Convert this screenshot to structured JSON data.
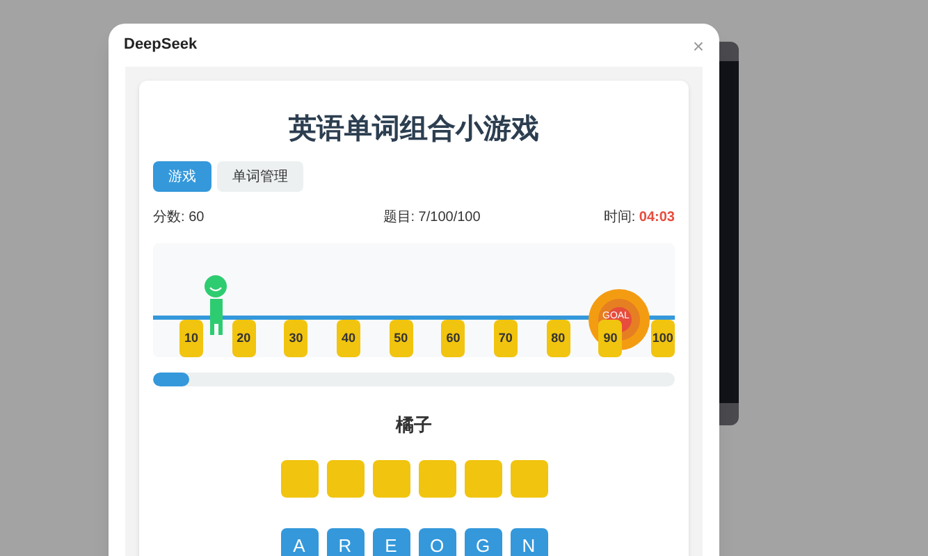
{
  "dialog": {
    "title": "DeepSeek",
    "close": "×"
  },
  "game": {
    "title": "英语单词组合小游戏",
    "tabs": [
      {
        "label": "游戏",
        "selected": true
      },
      {
        "label": "单词管理",
        "selected": false
      }
    ],
    "stats": {
      "score_label": "分数: ",
      "score": "60",
      "question": "题目: 7/100/100",
      "time_label": "时间: ",
      "time": "04:03"
    },
    "track": {
      "goal": "GOAL",
      "markers": [
        "10",
        "20",
        "30",
        "40",
        "50",
        "60",
        "70",
        "80",
        "90",
        "100"
      ]
    },
    "progress": {
      "level": 0.07
    },
    "word": "橘子",
    "slots": [
      {
        "filled": false
      },
      {
        "filled": false
      },
      {
        "filled": false
      },
      {
        "filled": false
      },
      {
        "filled": false
      },
      {
        "filled": false
      }
    ],
    "letters": [
      "A",
      "R",
      "E",
      "O",
      "G",
      "N"
    ]
  }
}
